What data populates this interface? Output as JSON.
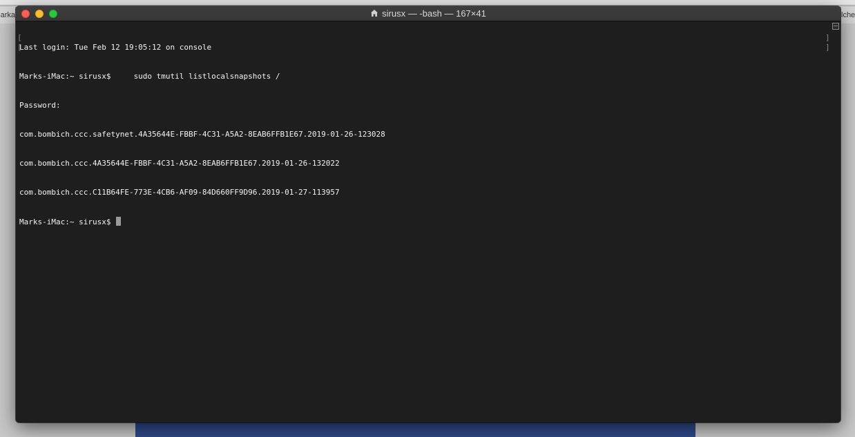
{
  "background": {
    "left_tab_text": "arka",
    "right_tab_text": "lche"
  },
  "window": {
    "title": "sirusx — -bash — 167×41",
    "title_icon": "home-icon"
  },
  "terminal": {
    "lines": [
      "Last login: Tue Feb 12 19:05:12 on console",
      "Marks-iMac:~ sirusx$     sudo tmutil listlocalsnapshots /",
      "Password:",
      "com.bombich.ccc.safetynet.4A35644E-FBBF-4C31-A5A2-8EAB6FFB1E67.2019-01-26-123028",
      "com.bombich.ccc.4A35644E-FBBF-4C31-A5A2-8EAB6FFB1E67.2019-01-26-132022",
      "com.bombich.ccc.C11B64FE-773E-4CB6-AF09-84D660FF9D96.2019-01-27-113957"
    ],
    "prompt": "Marks-iMac:~ sirusx$ "
  },
  "colors": {
    "terminal_bg": "#1e1e1e",
    "text": "#f2f2f2",
    "close": "#fe5f57",
    "minimize": "#febc2e",
    "zoom": "#28c840"
  }
}
